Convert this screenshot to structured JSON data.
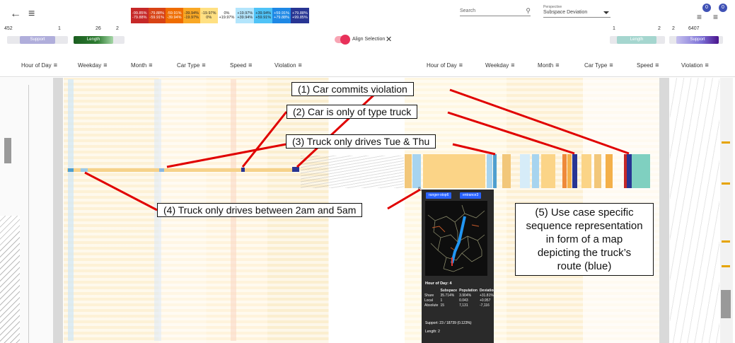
{
  "topbar": {
    "back_icon": "arrow-left-icon",
    "menu_icon": "hamburger-menu-icon",
    "search_placeholder": "Search",
    "perspective_label": "Perspective",
    "perspective_value": "Subspace Deviation",
    "badge_left": "0",
    "badge_right": "0"
  },
  "legend": [
    {
      "top": "-99.85%",
      "bottom": "-79.88%",
      "bg": "#c62828",
      "fg": "#ffffff"
    },
    {
      "top": "-79.88%",
      "bottom": "-59.91%",
      "bg": "#d84315",
      "fg": "#ffffff"
    },
    {
      "top": "-59.91%",
      "bottom": "-39.94%",
      "bg": "#ef6c00",
      "fg": "#ffffff"
    },
    {
      "top": "-39.94%",
      "bottom": "-19.97%",
      "bg": "#f9a825",
      "fg": "#222222"
    },
    {
      "top": "-19.97%",
      "bottom": "0%",
      "bg": "#ffe082",
      "fg": "#222222"
    },
    {
      "top": "0%",
      "bottom": "+19.97%",
      "bg": "#ffffff",
      "fg": "#222222"
    },
    {
      "top": "+19.97%",
      "bottom": "+39.94%",
      "bg": "#b3e5fc",
      "fg": "#222222"
    },
    {
      "top": "+39.94%",
      "bottom": "+59.91%",
      "bg": "#4fc3f7",
      "fg": "#222222"
    },
    {
      "top": "+59.91%",
      "bottom": "+79.88%",
      "bg": "#1e88e5",
      "fg": "#ffffff"
    },
    {
      "top": "+79.88%",
      "bottom": "+99.85%",
      "bg": "#283593",
      "fg": "#ffffff"
    }
  ],
  "left_controls": {
    "support_min": "452",
    "support_max": "1",
    "support_label": "Support",
    "length_min": "26",
    "length_max": "2",
    "length_label": "Length"
  },
  "right_controls": {
    "length_min": "1",
    "length_max": "2",
    "length_label": "Length",
    "support_min": "2",
    "support_max": "6407",
    "support_label": "Support"
  },
  "align": {
    "label": "Align Selection",
    "close": "✕"
  },
  "headers_left": [
    "Hour of Day",
    "Weekday",
    "Month",
    "Car Type",
    "Speed",
    "Violation"
  ],
  "headers_right": [
    "Hour of Day",
    "Weekday",
    "Month",
    "Car Type",
    "Speed",
    "Violation"
  ],
  "annotations": {
    "a1": "(1) Car commits violation",
    "a2": "(2) Car is only of type truck",
    "a3": "(3) Truck only drives Tue & Thu",
    "a4": "(4) Truck only drives between 2am and 5am",
    "a5_lines": [
      "(5) Use case specific",
      "sequence representation",
      "in form of a map",
      "depicting the truck’s",
      "route (blue)"
    ]
  },
  "tooltip": {
    "tags": [
      "ranger-stop6",
      "entrance3"
    ],
    "title": "Hour of Day: 4",
    "columns": [
      "",
      "Subspace",
      "Population",
      "Deviation"
    ],
    "rows": [
      [
        "Share",
        "35.714%",
        "3.904%",
        "+31.81%"
      ],
      [
        "Local",
        "1",
        "0.043",
        "+0.957"
      ],
      [
        "Absolute",
        "15",
        "7,131",
        "-7,116"
      ]
    ],
    "support": "Support: 23 / 18739 (0.123%)",
    "length": "Length: 2"
  },
  "colors": {
    "accent": "#3f51b5",
    "highlight_line": "#e00000",
    "toggle": "#e8315a"
  }
}
